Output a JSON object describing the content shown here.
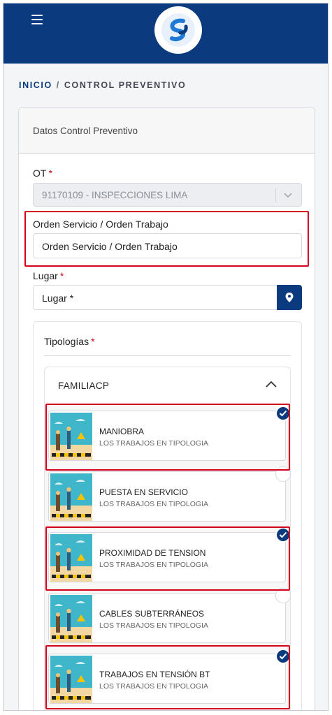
{
  "breadcrumb": {
    "home": "INICIO",
    "separator": "/",
    "current": "CONTROL PREVENTIVO"
  },
  "card": {
    "title": "Datos Control Preventivo",
    "ot": {
      "label": "OT",
      "required_mark": "*",
      "value": "91170109 - INSPECCIONES LIMA"
    },
    "orden": {
      "label": "Orden Servicio / Orden Trabajo",
      "placeholder": "Orden Servicio / Orden Trabajo"
    },
    "lugar": {
      "label": "Lugar",
      "required_mark": "*",
      "placeholder": "Lugar *"
    },
    "tipologias": {
      "label": "Tipologías",
      "required_mark": "*",
      "family": "FAMILIACP",
      "items": [
        {
          "name": "MANIOBRA",
          "desc": "LOS TRABAJOS EN TIPOLOGIA",
          "checked": true
        },
        {
          "name": "PUESTA EN SERVICIO",
          "desc": "LOS TRABAJOS EN TIPOLOGIA",
          "checked": false
        },
        {
          "name": "PROXIMIDAD DE TENSION",
          "desc": "LOS TRABAJOS EN TIPOLOGIA",
          "checked": true
        },
        {
          "name": "CABLES SUBTERRÁNEOS",
          "desc": "LOS TRABAJOS EN TIPOLOGIA",
          "checked": false
        },
        {
          "name": "TRABAJOS EN TENSIÓN BT",
          "desc": "LOS TRABAJOS EN TIPOLOGIA",
          "checked": true
        }
      ]
    }
  },
  "icons": [
    "hamburger-icon",
    "logo-icon",
    "chevron-down-icon",
    "map-pin-icon",
    "chevron-up-icon",
    "check-icon"
  ],
  "colors": {
    "brand": "#0b3a7e",
    "highlight": "#d6001c",
    "required": "#d0021b"
  }
}
